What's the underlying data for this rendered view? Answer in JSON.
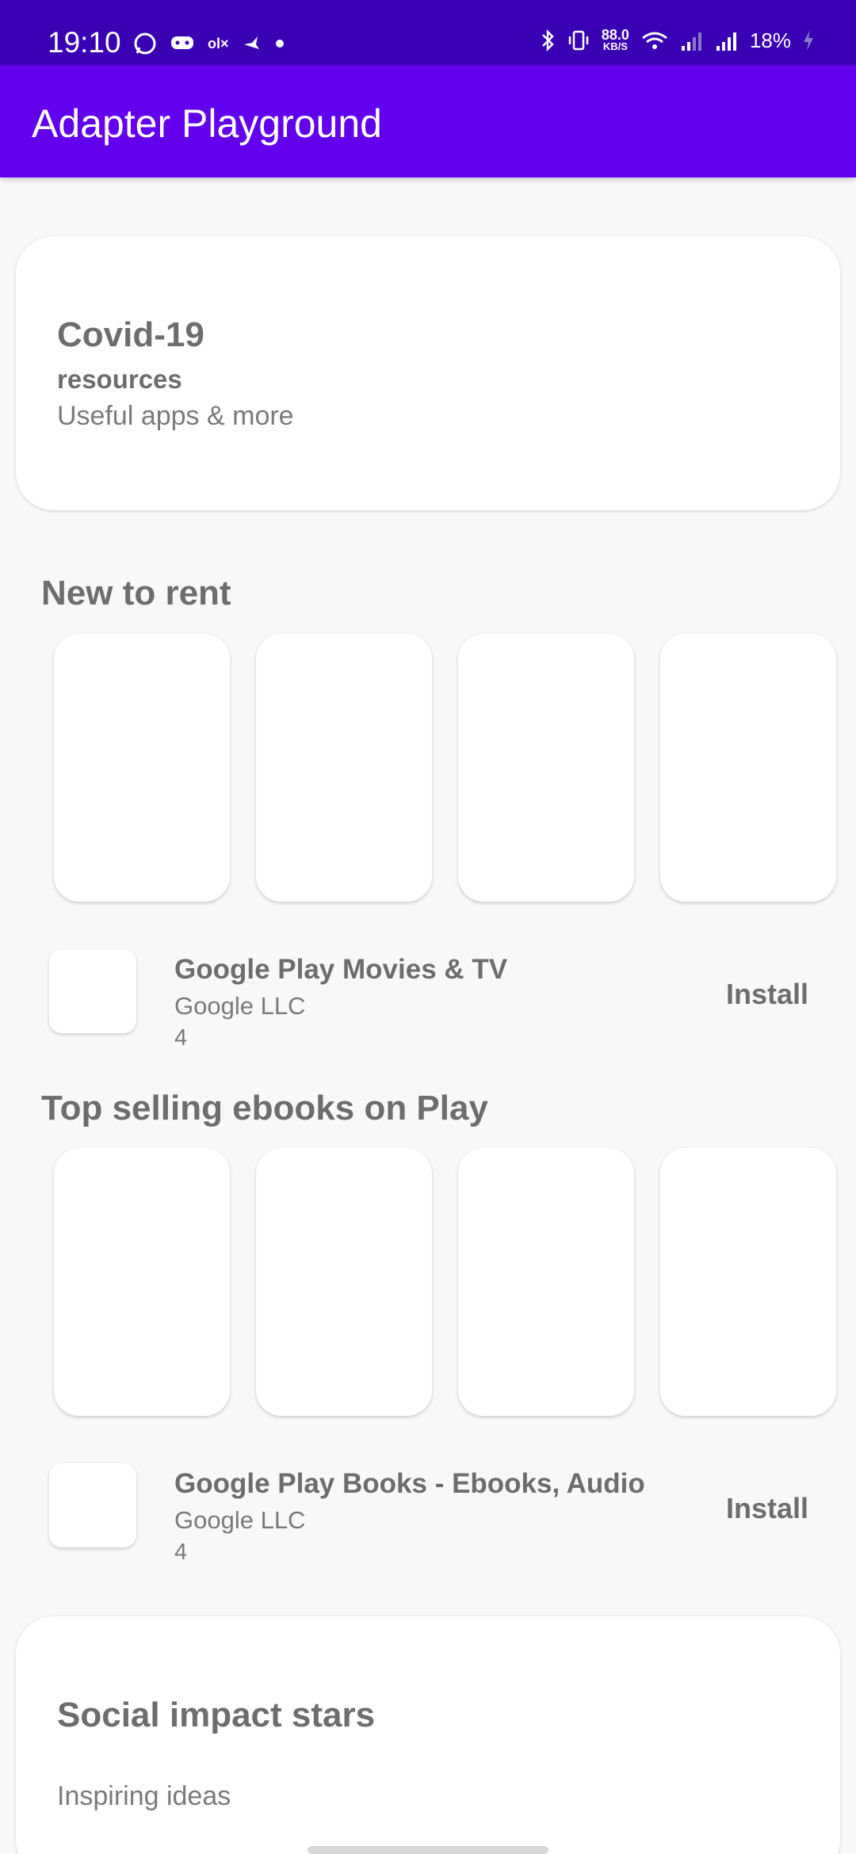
{
  "status_bar": {
    "time": "19:10",
    "speed_value": "88.0",
    "speed_unit": "KB/S",
    "battery": "18%"
  },
  "app_bar": {
    "title": "Adapter Playground"
  },
  "covid_card": {
    "title": "Covid-19",
    "subtitle": "resources",
    "description": "Useful apps & more"
  },
  "sections": [
    {
      "title": "New to rent",
      "app": {
        "name": "Google Play Movies & TV",
        "developer": "Google LLC",
        "rating": "4",
        "action": "Install"
      }
    },
    {
      "title": "Top selling ebooks on Play",
      "app": {
        "name": "Google Play Books - Ebooks, Audio",
        "developer": "Google LLC",
        "rating": "4",
        "action": "Install"
      }
    }
  ],
  "social_card": {
    "title": "Social impact stars",
    "description": "Inspiring ideas"
  },
  "colors": {
    "status_bar": "#3a00b4",
    "app_bar": "#6200ee",
    "background": "#f8f8f8"
  }
}
